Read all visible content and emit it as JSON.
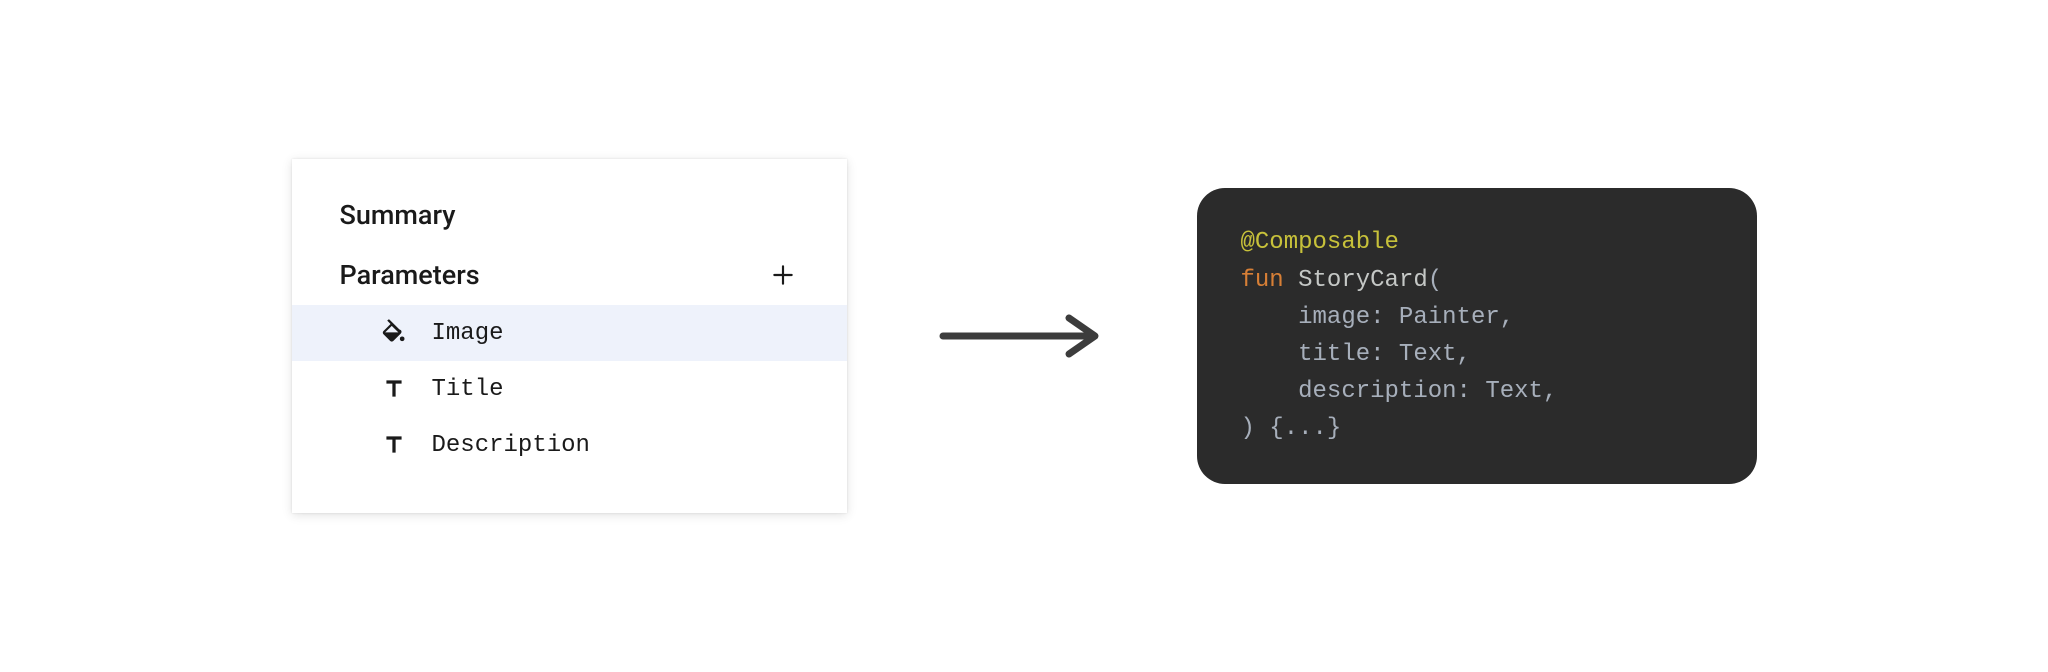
{
  "panel": {
    "heading": "Summary",
    "section_title": "Parameters",
    "add_label": "Add parameter",
    "params": [
      {
        "label": "Image",
        "icon": "fill-icon",
        "selected": true
      },
      {
        "label": "Title",
        "icon": "text-icon",
        "selected": false
      },
      {
        "label": "Description",
        "icon": "text-icon",
        "selected": false
      }
    ]
  },
  "code": {
    "annotation": "@Composable",
    "keyword": "fun",
    "fn_name": "StoryCard",
    "open": "(",
    "params": [
      "image: Painter,",
      "title: Text,",
      "description: Text,"
    ],
    "close": ")",
    "body": " {...}"
  }
}
